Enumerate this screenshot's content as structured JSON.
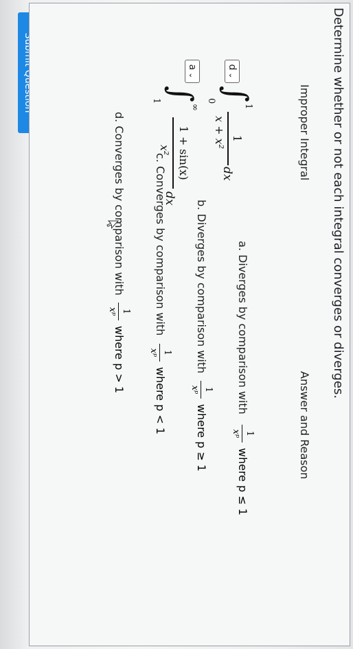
{
  "prompt": "Determine whether or not each integral converges or diverges.",
  "columns": {
    "integral": "Improper Integral",
    "answer": "Answer and Reason"
  },
  "rows": [
    {
      "selected": "d",
      "chevron": "⌄",
      "lower": "0",
      "upper": "1",
      "numerator": "1",
      "denominator": "x + x²",
      "differential": "dx"
    },
    {
      "selected": "a",
      "chevron": "⌄",
      "lower": "1",
      "upper": "∞",
      "numerator": "1 + sin(x)",
      "denominator": "x²",
      "differential": "dx"
    }
  ],
  "options": [
    {
      "prefix": "a. Diverges by comparison with",
      "num": "1",
      "den": "xᵖ",
      "condition": "where p ≤ 1"
    },
    {
      "prefix": "b. Diverges by comparison with",
      "num": "1",
      "den": "xᵖ",
      "condition": "where p ≥ 1"
    },
    {
      "prefix": "c. Converges by comparison with",
      "num": "1",
      "den": "xᵖ",
      "condition": "where p < 1"
    },
    {
      "prefix": "d. Converges by comparison with",
      "num": "1",
      "den": "xᵖ",
      "condition": "where p > 1"
    }
  ],
  "close_icon": "×",
  "submit_label": "Submit Question",
  "colors": {
    "submit": "#1e88e5",
    "close": "#c0392b"
  }
}
